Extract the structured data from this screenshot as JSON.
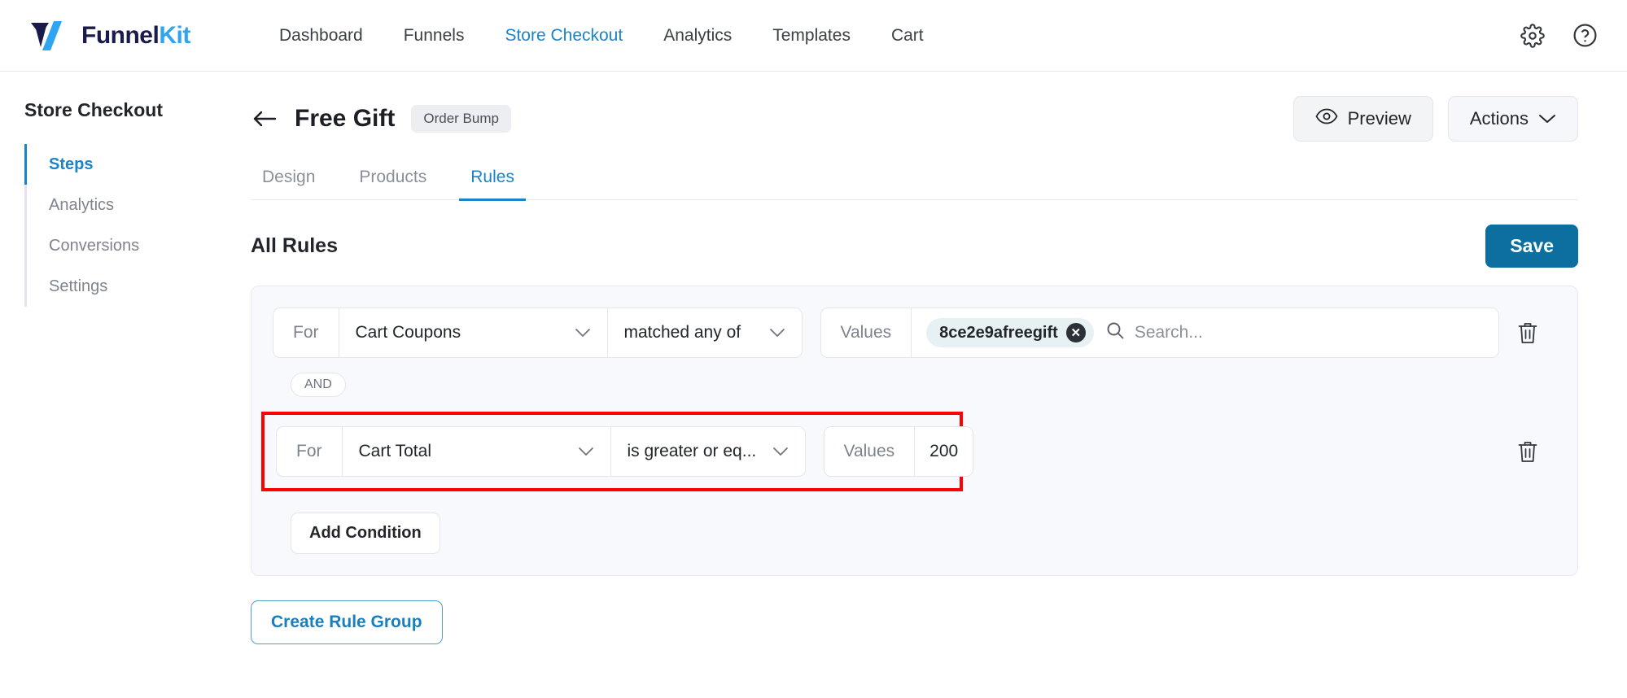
{
  "topnav": {
    "logo": {
      "first": "Funnel",
      "second": "Kit"
    },
    "items": [
      {
        "label": "Dashboard",
        "active": false
      },
      {
        "label": "Funnels",
        "active": false
      },
      {
        "label": "Store Checkout",
        "active": true
      },
      {
        "label": "Analytics",
        "active": false
      },
      {
        "label": "Templates",
        "active": false
      },
      {
        "label": "Cart",
        "active": false
      }
    ],
    "icons": [
      {
        "name": "gear-icon"
      },
      {
        "name": "help-circle-icon"
      }
    ]
  },
  "sidebar": {
    "title": "Store Checkout",
    "items": [
      {
        "label": "Steps",
        "active": true
      },
      {
        "label": "Analytics",
        "active": false
      },
      {
        "label": "Conversions",
        "active": false
      },
      {
        "label": "Settings",
        "active": false
      }
    ]
  },
  "page": {
    "back_icon": "arrow-left-icon",
    "title": "Free Gift",
    "badge": "Order Bump",
    "preview_label": "Preview",
    "actions_label": "Actions"
  },
  "tabs": [
    {
      "label": "Design",
      "active": false
    },
    {
      "label": "Products",
      "active": false
    },
    {
      "label": "Rules",
      "active": true
    }
  ],
  "rules_section": {
    "heading": "All Rules",
    "save_label": "Save",
    "add_condition_label": "Add Condition",
    "create_rule_group_label": "Create Rule Group",
    "and_label": "AND",
    "conditions": [
      {
        "for_label": "For",
        "field": "Cart Coupons",
        "operator": "matched any of",
        "values_label": "Values",
        "chips": [
          "8ce2e9afreegift"
        ],
        "search_placeholder": "Search...",
        "value_text": "",
        "highlighted": false
      },
      {
        "for_label": "For",
        "field": "Cart Total",
        "operator": "is greater or eq...",
        "values_label": "Values",
        "chips": [],
        "search_placeholder": "",
        "value_text": "200",
        "highlighted": true
      }
    ]
  },
  "colors": {
    "accent_blue": "#1a84c7",
    "save_blue": "#0d6f9f",
    "logo_navy": "#1b1b4b",
    "logo_cyan": "#2ea4f2",
    "highlight_red": "#ff0000",
    "chip_bg": "#e7f1f3"
  }
}
